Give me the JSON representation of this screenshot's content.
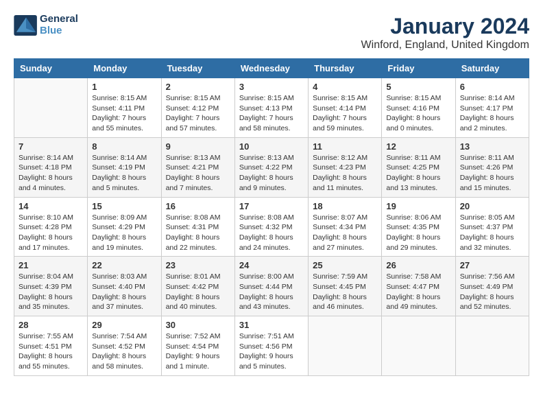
{
  "header": {
    "logo_line1": "General",
    "logo_line2": "Blue",
    "month": "January 2024",
    "location": "Winford, England, United Kingdom"
  },
  "weekdays": [
    "Sunday",
    "Monday",
    "Tuesday",
    "Wednesday",
    "Thursday",
    "Friday",
    "Saturday"
  ],
  "weeks": [
    [
      {
        "day": "",
        "info": ""
      },
      {
        "day": "1",
        "info": "Sunrise: 8:15 AM\nSunset: 4:11 PM\nDaylight: 7 hours\nand 55 minutes."
      },
      {
        "day": "2",
        "info": "Sunrise: 8:15 AM\nSunset: 4:12 PM\nDaylight: 7 hours\nand 57 minutes."
      },
      {
        "day": "3",
        "info": "Sunrise: 8:15 AM\nSunset: 4:13 PM\nDaylight: 7 hours\nand 58 minutes."
      },
      {
        "day": "4",
        "info": "Sunrise: 8:15 AM\nSunset: 4:14 PM\nDaylight: 7 hours\nand 59 minutes."
      },
      {
        "day": "5",
        "info": "Sunrise: 8:15 AM\nSunset: 4:16 PM\nDaylight: 8 hours\nand 0 minutes."
      },
      {
        "day": "6",
        "info": "Sunrise: 8:14 AM\nSunset: 4:17 PM\nDaylight: 8 hours\nand 2 minutes."
      }
    ],
    [
      {
        "day": "7",
        "info": "Sunrise: 8:14 AM\nSunset: 4:18 PM\nDaylight: 8 hours\nand 4 minutes."
      },
      {
        "day": "8",
        "info": "Sunrise: 8:14 AM\nSunset: 4:19 PM\nDaylight: 8 hours\nand 5 minutes."
      },
      {
        "day": "9",
        "info": "Sunrise: 8:13 AM\nSunset: 4:21 PM\nDaylight: 8 hours\nand 7 minutes."
      },
      {
        "day": "10",
        "info": "Sunrise: 8:13 AM\nSunset: 4:22 PM\nDaylight: 8 hours\nand 9 minutes."
      },
      {
        "day": "11",
        "info": "Sunrise: 8:12 AM\nSunset: 4:23 PM\nDaylight: 8 hours\nand 11 minutes."
      },
      {
        "day": "12",
        "info": "Sunrise: 8:11 AM\nSunset: 4:25 PM\nDaylight: 8 hours\nand 13 minutes."
      },
      {
        "day": "13",
        "info": "Sunrise: 8:11 AM\nSunset: 4:26 PM\nDaylight: 8 hours\nand 15 minutes."
      }
    ],
    [
      {
        "day": "14",
        "info": "Sunrise: 8:10 AM\nSunset: 4:28 PM\nDaylight: 8 hours\nand 17 minutes."
      },
      {
        "day": "15",
        "info": "Sunrise: 8:09 AM\nSunset: 4:29 PM\nDaylight: 8 hours\nand 19 minutes."
      },
      {
        "day": "16",
        "info": "Sunrise: 8:08 AM\nSunset: 4:31 PM\nDaylight: 8 hours\nand 22 minutes."
      },
      {
        "day": "17",
        "info": "Sunrise: 8:08 AM\nSunset: 4:32 PM\nDaylight: 8 hours\nand 24 minutes."
      },
      {
        "day": "18",
        "info": "Sunrise: 8:07 AM\nSunset: 4:34 PM\nDaylight: 8 hours\nand 27 minutes."
      },
      {
        "day": "19",
        "info": "Sunrise: 8:06 AM\nSunset: 4:35 PM\nDaylight: 8 hours\nand 29 minutes."
      },
      {
        "day": "20",
        "info": "Sunrise: 8:05 AM\nSunset: 4:37 PM\nDaylight: 8 hours\nand 32 minutes."
      }
    ],
    [
      {
        "day": "21",
        "info": "Sunrise: 8:04 AM\nSunset: 4:39 PM\nDaylight: 8 hours\nand 35 minutes."
      },
      {
        "day": "22",
        "info": "Sunrise: 8:03 AM\nSunset: 4:40 PM\nDaylight: 8 hours\nand 37 minutes."
      },
      {
        "day": "23",
        "info": "Sunrise: 8:01 AM\nSunset: 4:42 PM\nDaylight: 8 hours\nand 40 minutes."
      },
      {
        "day": "24",
        "info": "Sunrise: 8:00 AM\nSunset: 4:44 PM\nDaylight: 8 hours\nand 43 minutes."
      },
      {
        "day": "25",
        "info": "Sunrise: 7:59 AM\nSunset: 4:45 PM\nDaylight: 8 hours\nand 46 minutes."
      },
      {
        "day": "26",
        "info": "Sunrise: 7:58 AM\nSunset: 4:47 PM\nDaylight: 8 hours\nand 49 minutes."
      },
      {
        "day": "27",
        "info": "Sunrise: 7:56 AM\nSunset: 4:49 PM\nDaylight: 8 hours\nand 52 minutes."
      }
    ],
    [
      {
        "day": "28",
        "info": "Sunrise: 7:55 AM\nSunset: 4:51 PM\nDaylight: 8 hours\nand 55 minutes."
      },
      {
        "day": "29",
        "info": "Sunrise: 7:54 AM\nSunset: 4:52 PM\nDaylight: 8 hours\nand 58 minutes."
      },
      {
        "day": "30",
        "info": "Sunrise: 7:52 AM\nSunset: 4:54 PM\nDaylight: 9 hours\nand 1 minute."
      },
      {
        "day": "31",
        "info": "Sunrise: 7:51 AM\nSunset: 4:56 PM\nDaylight: 9 hours\nand 5 minutes."
      },
      {
        "day": "",
        "info": ""
      },
      {
        "day": "",
        "info": ""
      },
      {
        "day": "",
        "info": ""
      }
    ]
  ]
}
